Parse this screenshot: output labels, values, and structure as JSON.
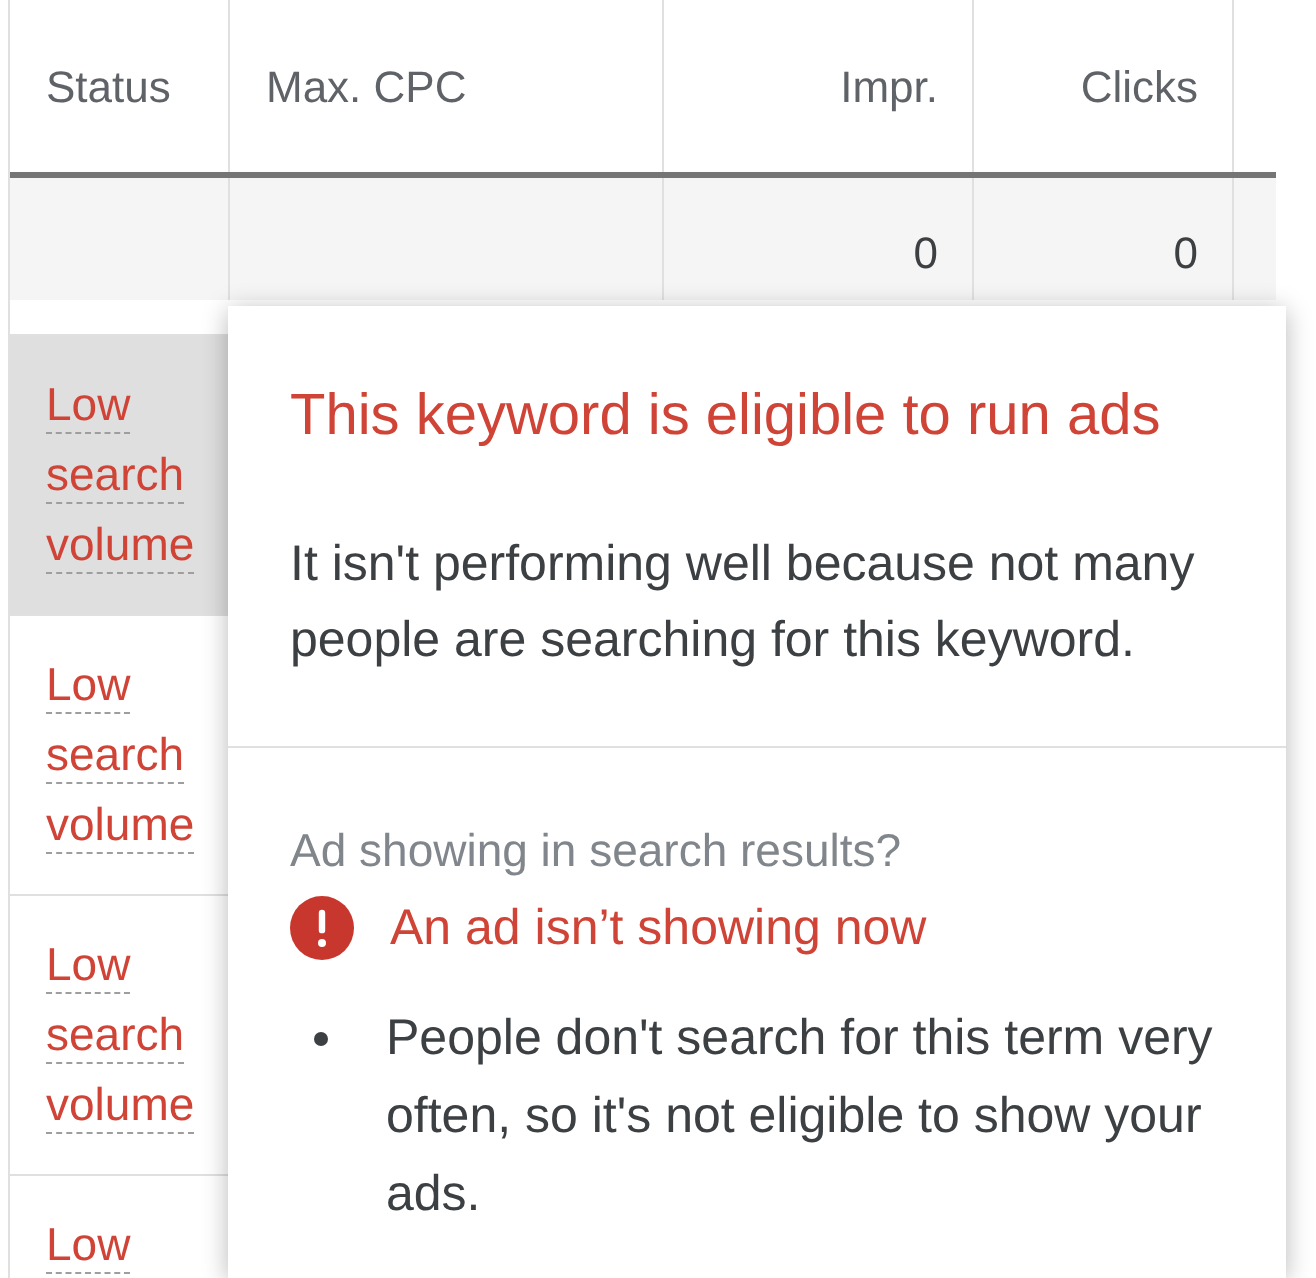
{
  "table": {
    "columns": [
      {
        "label": "Status",
        "kind": "text"
      },
      {
        "label": "Max. CPC",
        "kind": "text"
      },
      {
        "label": "Impr.",
        "kind": "number",
        "total": "0"
      },
      {
        "label": "Clicks",
        "kind": "number",
        "total": "0"
      }
    ],
    "rows": [
      {
        "status": "Low search volume",
        "highlighted": true
      },
      {
        "status": "Low search volume",
        "highlighted": false
      },
      {
        "status": "Low search volume",
        "highlighted": false
      },
      {
        "status": "Low",
        "highlighted": false
      }
    ]
  },
  "popover": {
    "title": "This keyword is eligible to run ads",
    "description": "It isn't performing well because not many people are searching for this keyword.",
    "section_label": "Ad showing in search results?",
    "alert": {
      "kind": "error",
      "text": "An ad isn’t showing now"
    },
    "reasons": [
      "People don't search for this term very often, so it's not eligible to show your ads."
    ]
  }
}
